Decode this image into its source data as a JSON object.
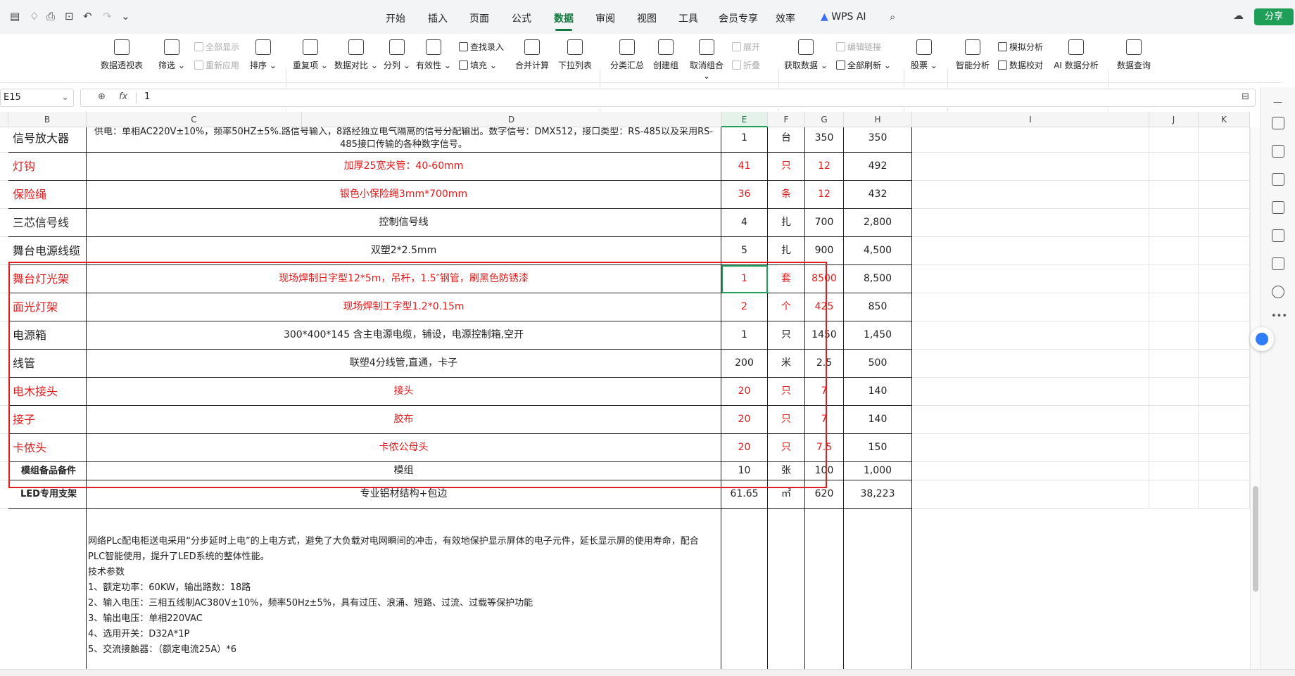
{
  "menu": {
    "tabs": [
      "开始",
      "插入",
      "页面",
      "公式",
      "数据",
      "审阅",
      "视图",
      "工具",
      "会员专享",
      "效率",
      "WPS AI"
    ],
    "active": "数据",
    "share_label": "分享"
  },
  "ribbon": {
    "big": [
      "数据透视表",
      "筛选",
      "排序",
      "重复项",
      "数据对比",
      "分列",
      "有效性",
      "合并计算",
      "下拉列表",
      "分类汇总",
      "创建组",
      "取消组合",
      "获取数据",
      "股票",
      "智能分析",
      "AI 数据分析",
      "数据查询"
    ],
    "small": [
      "全部显示",
      "重新应用",
      "查找录入",
      "填充",
      "展开",
      "折叠",
      "编辑链接",
      "全部刷新",
      "模拟分析",
      "数据校对"
    ]
  },
  "formula_bar": {
    "cell_ref": "E15",
    "value": "1",
    "fx": "fx"
  },
  "columns": [
    "B",
    "C",
    "D",
    "E",
    "F",
    "G",
    "H",
    "I",
    "J",
    "K"
  ],
  "rows": [
    {
      "name": "信号放大器",
      "desc": "供电：单相AC220V±10%，频率50HZ±5%.路信号输入，8路经独立电气隔离的信号分配输出。数字信号：DMX512，接口类型：RS-485以及采用RS-485接口传输的各种数字信号。",
      "qty": "1",
      "unit": "台",
      "price": "350",
      "total": "350",
      "red": false
    },
    {
      "name": "灯钩",
      "desc": "加厚25宽夹管：40-60mm",
      "qty": "41",
      "unit": "只",
      "price": "12",
      "total": "492",
      "red": true
    },
    {
      "name": "保险绳",
      "desc": "银色小保险绳3mm*700mm",
      "qty": "36",
      "unit": "条",
      "price": "12",
      "total": "432",
      "red": true
    },
    {
      "name": "三芯信号线",
      "desc": "控制信号线",
      "qty": "4",
      "unit": "扎",
      "price": "700",
      "total": "2,800",
      "red": false
    },
    {
      "name": "舞台电源线缆",
      "desc": "双塑2*2.5mm",
      "qty": "5",
      "unit": "扎",
      "price": "900",
      "total": "4,500",
      "red": false
    },
    {
      "name": "舞台灯光架",
      "desc": "现场焊制日字型12*5m，吊杆，1.5″钢管，刷黑色防锈漆",
      "qty": "1",
      "unit": "套",
      "price": "8500",
      "total": "8,500",
      "red": true
    },
    {
      "name": "面光灯架",
      "desc": "现场焊制工字型1.2*0.15m",
      "qty": "2",
      "unit": "个",
      "price": "425",
      "total": "850",
      "red": true
    },
    {
      "name": "电源箱",
      "desc": "300*400*145 含主电源电缆，铺设，电源控制箱,空开",
      "qty": "1",
      "unit": "只",
      "price": "1450",
      "total": "1,450",
      "red": false
    },
    {
      "name": "线管",
      "desc": "联塑4分线管,直通，卡子",
      "qty": "200",
      "unit": "米",
      "price": "2.5",
      "total": "500",
      "red": false
    },
    {
      "name": "电木接头",
      "desc": "接头",
      "qty": "20",
      "unit": "只",
      "price": "7",
      "total": "140",
      "red": true
    },
    {
      "name": "接子",
      "desc": "胶布",
      "qty": "20",
      "unit": "只",
      "price": "7",
      "total": "140",
      "red": true
    },
    {
      "name": "卡侬头",
      "desc": "卡侬公母头",
      "qty": "20",
      "unit": "只",
      "price": "7.5",
      "total": "150",
      "red": true
    },
    {
      "name": "模组备品备件",
      "desc": "模组",
      "qty": "10",
      "unit": "张",
      "price": "100",
      "total": "1,000",
      "red": false
    },
    {
      "name": "LED专用支架",
      "desc": "专业铝材结构+包边",
      "qty": "61.65",
      "unit": "㎡",
      "price": "620",
      "total": "38,223",
      "red": false
    }
  ],
  "big_note": {
    "lines": [
      "网络PLc配电柜送电采用“分步延时上电”的上电方式，避免了大负载对电网瞬间的冲击，有效地保护显示屏体的电子元件，延长显示屏的使用寿命，配合",
      "PLC智能使用，提升了LED系统的整体性能。",
      "技术参数",
      "1、额定功率：60KW，输出路数：18路",
      "2、输入电压：三相五线制AC380V±10%，频率50Hz±5%，具有过压、浪涌、短路、过流、过载等保护功能",
      "3、输出电压：单相220VAC",
      "4、选用开关：D32A*1P",
      "5、交流接触器：（额定电流25A）*6"
    ]
  }
}
